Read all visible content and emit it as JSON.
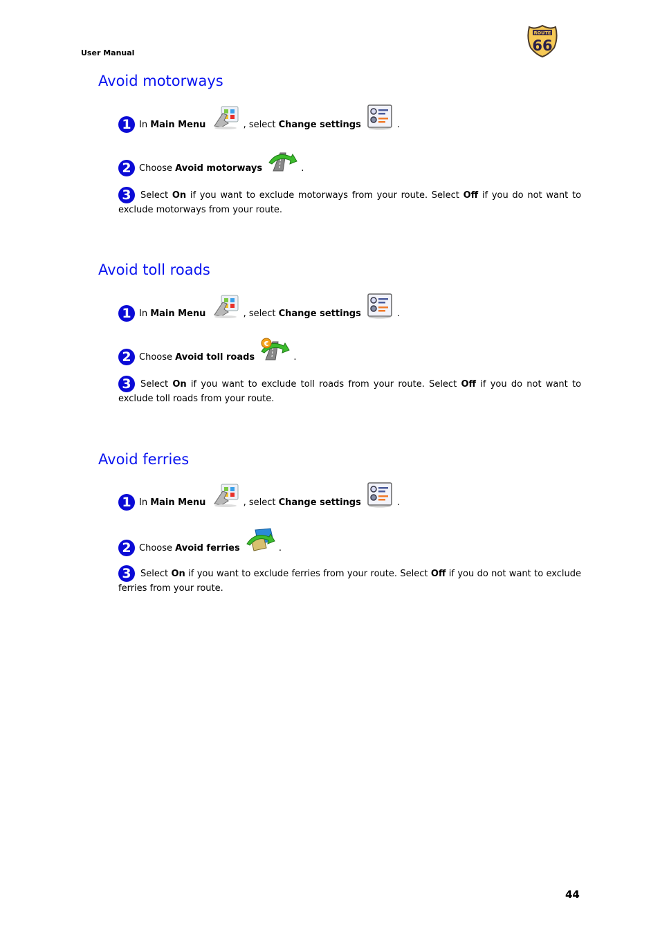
{
  "header": {
    "label": "User Manual",
    "logo_text_top": "ROUTE",
    "logo_text_num": "66"
  },
  "common": {
    "step1_in": "In",
    "step1_main_menu": "Main Menu",
    "step1_select": ", select",
    "step1_change_settings": "Change settings",
    "period": ".",
    "choose": "Choose",
    "select_word": "Select",
    "on": "On",
    "off": "Off",
    "num1": "1",
    "num2": "2",
    "num3": "3"
  },
  "sections": [
    {
      "title": "Avoid motorways",
      "option": "Avoid motorways",
      "icon": "avoid-motorways-icon",
      "text_a": "if you want to exclude motorways from your route. Select",
      "text_b": "if you do not want to exclude motorways from your route."
    },
    {
      "title": "Avoid toll roads",
      "option": "Avoid toll roads",
      "icon": "avoid-toll-roads-icon",
      "text_a": "if you want to exclude toll roads from your route. Select",
      "text_b": "if you do not want to exclude toll roads from your route."
    },
    {
      "title": "Avoid ferries",
      "option": "Avoid ferries",
      "icon": "avoid-ferries-icon",
      "text_a": "if you want to exclude ferries from your route. Select",
      "text_b": "if you do not want to exclude ferries from your route."
    }
  ],
  "footer": {
    "page_number": "44"
  }
}
